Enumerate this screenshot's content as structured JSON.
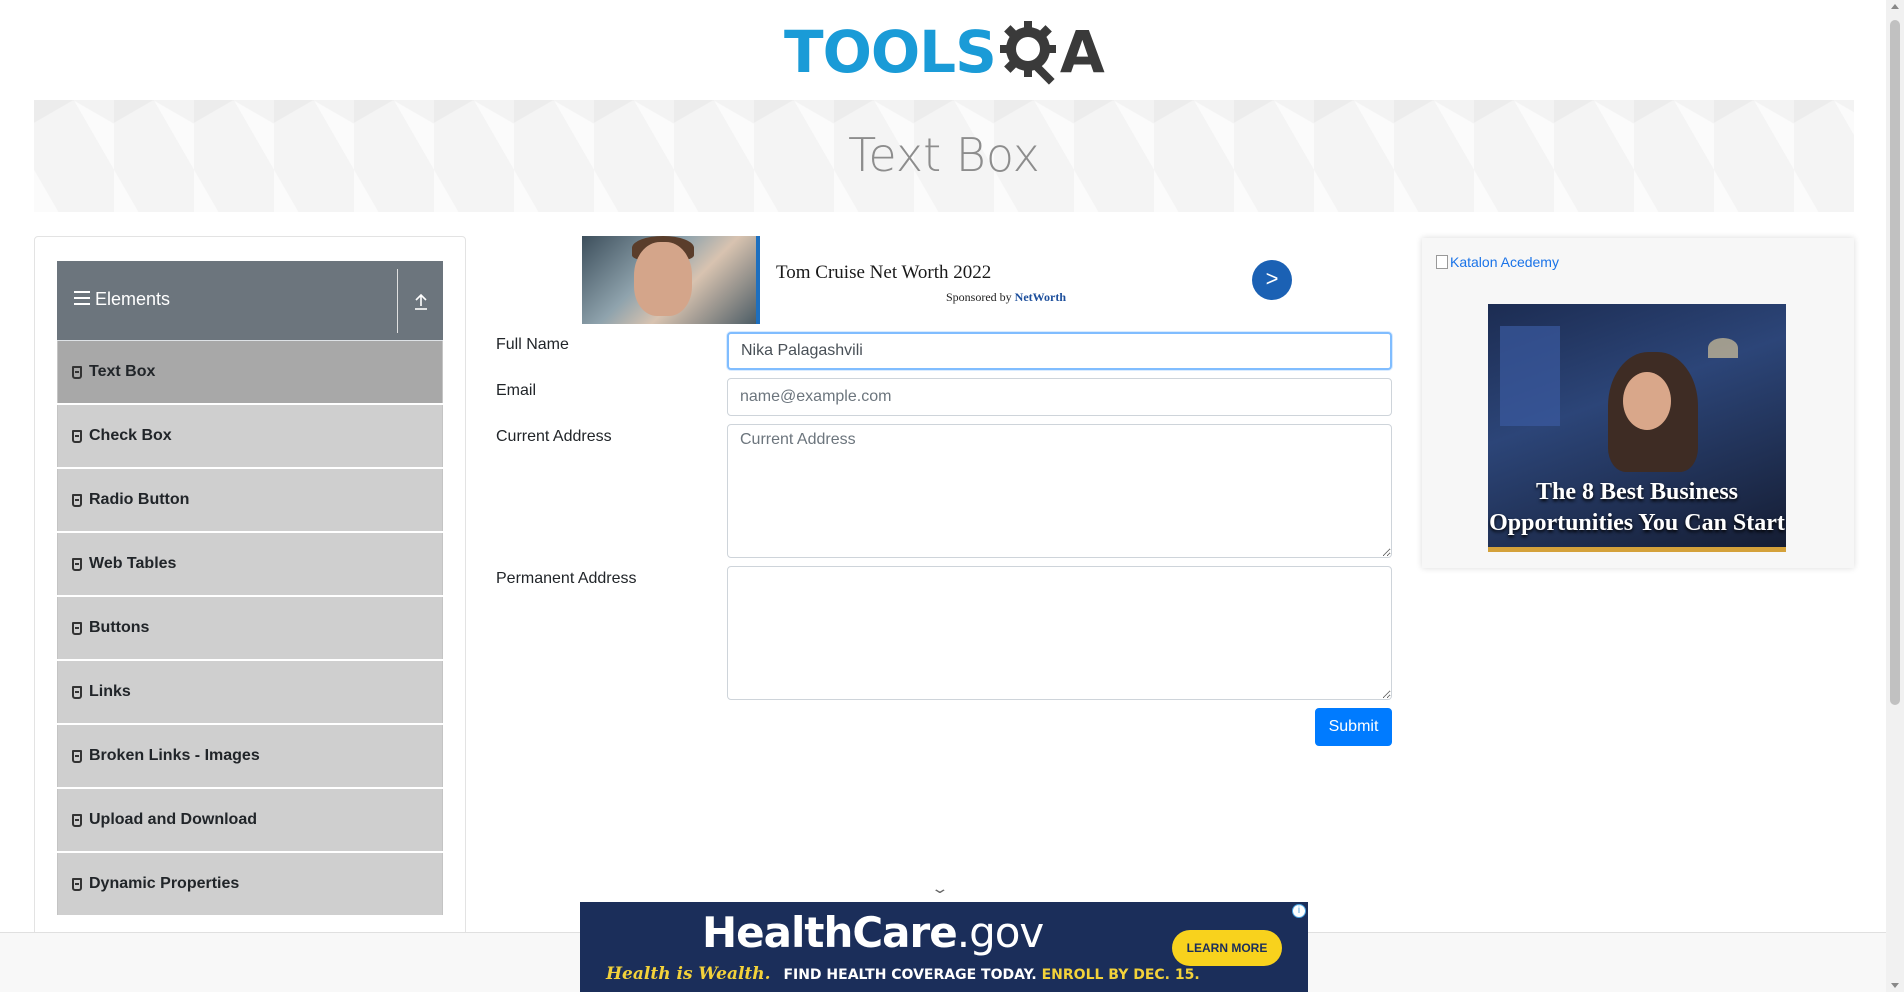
{
  "header": {
    "logo_tools": "TOOLS",
    "logo_q_icon": "gear-magnifier-icon",
    "logo_a": "A"
  },
  "banner": {
    "title": "Text Box"
  },
  "sidebar": {
    "group_title": "Elements",
    "menu_icon": "hamburger-icon",
    "collapse_icon": "upload-arrow-icon",
    "items": [
      {
        "label": "Text Box",
        "active": true
      },
      {
        "label": "Check Box"
      },
      {
        "label": "Radio Button"
      },
      {
        "label": "Web Tables"
      },
      {
        "label": "Buttons"
      },
      {
        "label": "Links"
      },
      {
        "label": "Broken Links - Images"
      },
      {
        "label": "Upload and Download"
      },
      {
        "label": "Dynamic Properties"
      }
    ]
  },
  "ad_top": {
    "title": "Tom Cruise Net Worth 2022",
    "sponsored_prefix": "Sponsored by",
    "sponsor": "NetWorth",
    "arrow": ">"
  },
  "form": {
    "full_name_label": "Full Name",
    "full_name_value": "Nika Palagashvili",
    "email_label": "Email",
    "email_placeholder": "name@example.com",
    "current_address_label": "Current Address",
    "current_address_placeholder": "Current Address",
    "permanent_address_label": "Permanent Address",
    "submit_label": "Submit"
  },
  "right_ad": {
    "broken_image_alt": "Katalon Acedemy",
    "headline": "The 8 Best Business Opportunities You Can Start"
  },
  "bottom_ad": {
    "brand": "HealthCare",
    "brand_suffix": ".gov",
    "tagline_script": "Health is Wealth.",
    "tagline_white": "FIND HEALTH COVERAGE TODAY.",
    "tagline_yellow": "ENROLL BY DEC. 15.",
    "button": "LEARN MORE",
    "info_icon": "i"
  },
  "colors": {
    "accent": "#007bff",
    "sidebar_header": "#6c757d",
    "menu_item": "#cfcfcf",
    "menu_item_active": "#a8a8a8",
    "logo_blue": "#1a9bd7"
  }
}
